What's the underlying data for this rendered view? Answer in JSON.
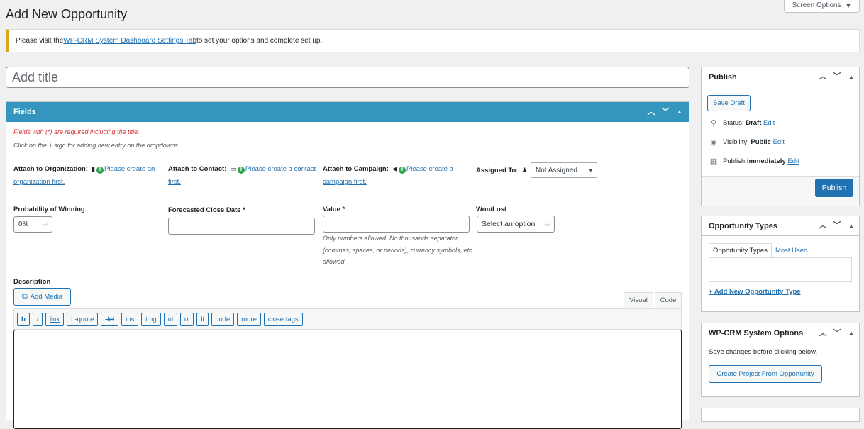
{
  "page": {
    "title": "Add New Opportunity",
    "screen_options": "Screen Options"
  },
  "notice": {
    "prefix": "Please visit the ",
    "link": "WP-CRM System Dashboard Settings Tab",
    "suffix": " to set your options and complete set up."
  },
  "title_field": {
    "placeholder": "Add title"
  },
  "fields": {
    "header": "Fields",
    "required_note": "Fields with (*) are required including the title.",
    "hint_note": "Click on the + sign for adding new entry on the dropdowns.",
    "attach_org": {
      "label": "Attach to Organization:",
      "link": "Please create an organization first."
    },
    "attach_contact": {
      "label": "Attach to Contact:",
      "link": "Please create a contact first."
    },
    "attach_campaign": {
      "label": "Attach to Campaign:",
      "link": "Please create a campaign first."
    },
    "assigned_to": {
      "label": "Assigned To:",
      "value": "Not Assigned"
    },
    "probability": {
      "label": "Probability of Winning",
      "value": "0%"
    },
    "close_date": {
      "label": "Forecasted Close Date *"
    },
    "value": {
      "label": "Value *",
      "hint": "Only numbers allowed. No thousands separator (commas, spaces, or periods), currency symbols, etc. allowed."
    },
    "won_lost": {
      "label": "Won/Lost",
      "value": "Select an option"
    },
    "description": {
      "label": "Description"
    },
    "add_media": "Add Media",
    "tabs": {
      "visual": "Visual",
      "code": "Code"
    },
    "quicktags": [
      "b",
      "i",
      "link",
      "b-quote",
      "del",
      "ins",
      "img",
      "ul",
      "ol",
      "li",
      "code",
      "more",
      "close tags"
    ]
  },
  "publish": {
    "title": "Publish",
    "save_draft": "Save Draft",
    "status_label": "Status:",
    "status_value": "Draft",
    "visibility_label": "Visibility:",
    "visibility_value": "Public",
    "publish_label": "Publish",
    "publish_value": "immediately",
    "edit": "Edit",
    "publish_button": "Publish"
  },
  "opportunity_types": {
    "title": "Opportunity Types",
    "tab_all": "Opportunity Types",
    "tab_most_used": "Most Used",
    "add_new": "+ Add New Opportunity Type"
  },
  "system_options": {
    "title": "WP-CRM System Options",
    "note": "Save changes before clicking below.",
    "button": "Create Project From Opportunity"
  }
}
